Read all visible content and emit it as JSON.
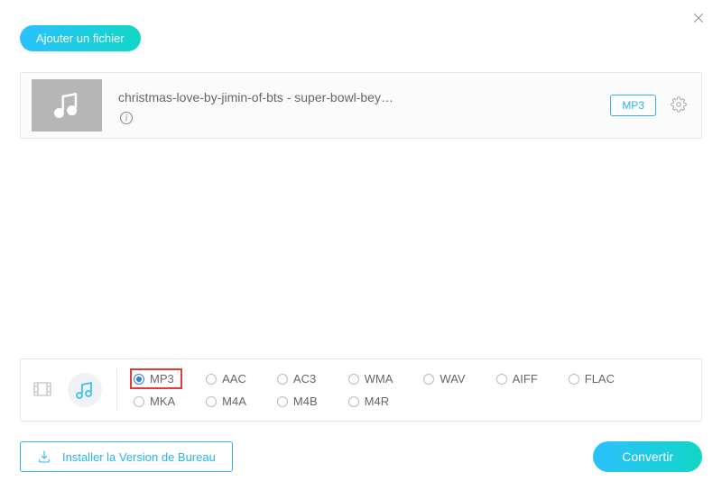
{
  "buttons": {
    "add_file": "Ajouter un fichier",
    "install_desktop": "Installer la Version de Bureau",
    "convert": "Convertir"
  },
  "file": {
    "name": "christmas-love-by-jimin-of-bts - super-bowl-bey…",
    "format_badge": "MP3"
  },
  "formats": {
    "row1": [
      {
        "label": "MP3",
        "selected": true,
        "highlighted": true
      },
      {
        "label": "AAC",
        "selected": false,
        "highlighted": false
      },
      {
        "label": "AC3",
        "selected": false,
        "highlighted": false
      },
      {
        "label": "WMA",
        "selected": false,
        "highlighted": false
      },
      {
        "label": "WAV",
        "selected": false,
        "highlighted": false
      },
      {
        "label": "AIFF",
        "selected": false,
        "highlighted": false
      },
      {
        "label": "FLAC",
        "selected": false,
        "highlighted": false
      }
    ],
    "row2": [
      {
        "label": "MKA",
        "selected": false,
        "highlighted": false
      },
      {
        "label": "M4A",
        "selected": false,
        "highlighted": false
      },
      {
        "label": "M4B",
        "selected": false,
        "highlighted": false
      },
      {
        "label": "M4R",
        "selected": false,
        "highlighted": false
      }
    ]
  }
}
